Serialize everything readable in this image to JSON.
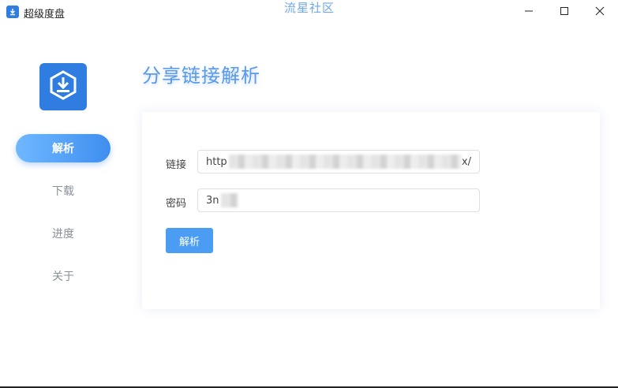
{
  "window": {
    "title": "超级度盘",
    "watermark": "流星社区",
    "controls": [
      "minimize",
      "maximize",
      "close"
    ]
  },
  "sidebar": {
    "logo_icon": "download-shield-icon",
    "items": [
      {
        "label": "解析",
        "active": true
      },
      {
        "label": "下载",
        "active": false
      },
      {
        "label": "进度",
        "active": false
      },
      {
        "label": "关于",
        "active": false
      }
    ]
  },
  "main": {
    "title": "分享链接解析",
    "form": {
      "link_label": "链接",
      "link_value_visible_start": "http",
      "link_value_visible_end": "x/",
      "password_label": "密码",
      "password_value_visible": "3n",
      "submit_label": "解析"
    }
  },
  "colors": {
    "accent": "#3f8ef0",
    "active_gradient_start": "#6fb8ff",
    "title_text": "#5b9ae8",
    "button": "#4b9df3",
    "logo": "#2f7de1"
  }
}
